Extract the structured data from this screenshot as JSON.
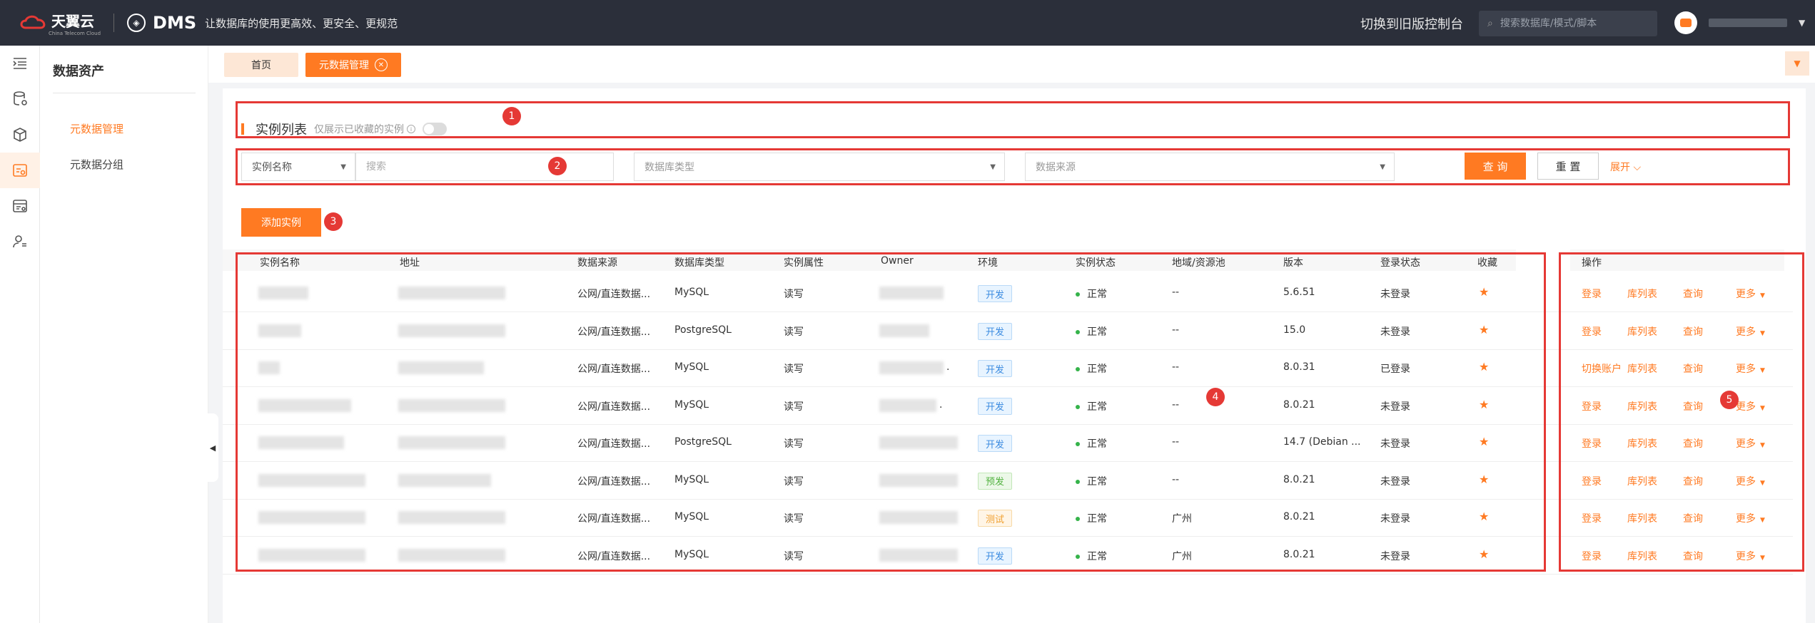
{
  "topbar": {
    "brand": "天翼云",
    "brand_sub": "China Telecom Cloud",
    "product": "DMS",
    "slogan": "让数据库的使用更高效、更安全、更规范",
    "switch_old": "切换到旧版控制台",
    "search_placeholder": "搜索数据库/模式/脚本"
  },
  "sidebar": {
    "title": "数据资产",
    "items": [
      {
        "label": "元数据管理",
        "active": true
      },
      {
        "label": "元数据分组",
        "active": false
      }
    ]
  },
  "tabs": [
    {
      "label": "首页"
    },
    {
      "label": "元数据管理",
      "active": true
    }
  ],
  "list": {
    "title": "实例列表",
    "note": "仅展示已收藏的实例",
    "info": "i"
  },
  "filters": {
    "field_select": "实例名称",
    "search_placeholder": "搜索",
    "dbtype_placeholder": "数据库类型",
    "dbsource_placeholder": "数据来源",
    "query": "查 询",
    "reset": "重 置",
    "expand": "展开"
  },
  "add_button": "添加实例",
  "badges": [
    "1",
    "2",
    "3",
    "4",
    "5"
  ],
  "table": {
    "headers": [
      "实例名称",
      "地址",
      "数据来源",
      "数据库类型",
      "实例属性",
      "Owner",
      "环境",
      "实例状态",
      "地域/资源池",
      "版本",
      "登录状态",
      "收藏"
    ],
    "op_header": "操作",
    "rows": [
      {
        "source": "公网/直连数据...",
        "dbtype": "MySQL",
        "attr": "读写",
        "env": "开发",
        "env_type": "dev",
        "status": "正常",
        "region": "--",
        "version": "5.6.51",
        "login": "未登录",
        "ops": [
          "登录",
          "库列表",
          "查询",
          "更多"
        ],
        "owner_suffix": ""
      },
      {
        "source": "公网/直连数据...",
        "dbtype": "PostgreSQL",
        "attr": "读写",
        "env": "开发",
        "env_type": "dev",
        "status": "正常",
        "region": "--",
        "version": "15.0",
        "login": "未登录",
        "ops": [
          "登录",
          "库列表",
          "查询",
          "更多"
        ],
        "owner_suffix": ""
      },
      {
        "source": "公网/直连数据...",
        "dbtype": "MySQL",
        "attr": "读写",
        "env": "开发",
        "env_type": "dev",
        "status": "正常",
        "region": "--",
        "version": "8.0.31",
        "login": "已登录",
        "ops": [
          "切换账户",
          "库列表",
          "查询",
          "更多"
        ],
        "owner_suffix": "."
      },
      {
        "source": "公网/直连数据...",
        "dbtype": "MySQL",
        "attr": "读写",
        "env": "开发",
        "env_type": "dev",
        "status": "正常",
        "region": "--",
        "version": "8.0.21",
        "login": "未登录",
        "ops": [
          "登录",
          "库列表",
          "查询",
          "更多"
        ],
        "owner_suffix": "."
      },
      {
        "source": "公网/直连数据...",
        "dbtype": "PostgreSQL",
        "attr": "读写",
        "env": "开发",
        "env_type": "dev",
        "status": "正常",
        "region": "--",
        "version": "14.7 (Debian ...",
        "login": "未登录",
        "ops": [
          "登录",
          "库列表",
          "查询",
          "更多"
        ],
        "owner_suffix": ""
      },
      {
        "source": "公网/直连数据...",
        "dbtype": "MySQL",
        "attr": "读写",
        "env": "预发",
        "env_type": "pre",
        "status": "正常",
        "region": "--",
        "version": "8.0.21",
        "login": "未登录",
        "ops": [
          "登录",
          "库列表",
          "查询",
          "更多"
        ],
        "owner_suffix": ""
      },
      {
        "source": "公网/直连数据...",
        "dbtype": "MySQL",
        "attr": "读写",
        "env": "测试",
        "env_type": "test",
        "status": "正常",
        "region": "广州",
        "version": "8.0.21",
        "login": "未登录",
        "ops": [
          "登录",
          "库列表",
          "查询",
          "更多"
        ],
        "owner_suffix": ""
      },
      {
        "source": "公网/直连数据...",
        "dbtype": "MySQL",
        "attr": "读写",
        "env": "开发",
        "env_type": "dev",
        "status": "正常",
        "region": "广州",
        "version": "8.0.21",
        "login": "未登录",
        "ops": [
          "登录",
          "库列表",
          "查询",
          "更多"
        ],
        "owner_suffix": ""
      }
    ]
  },
  "colors": {
    "accent": "#ff7a22",
    "topbar": "#2b2f3a",
    "annotation": "#e53935",
    "status_ok": "#35b34a"
  }
}
